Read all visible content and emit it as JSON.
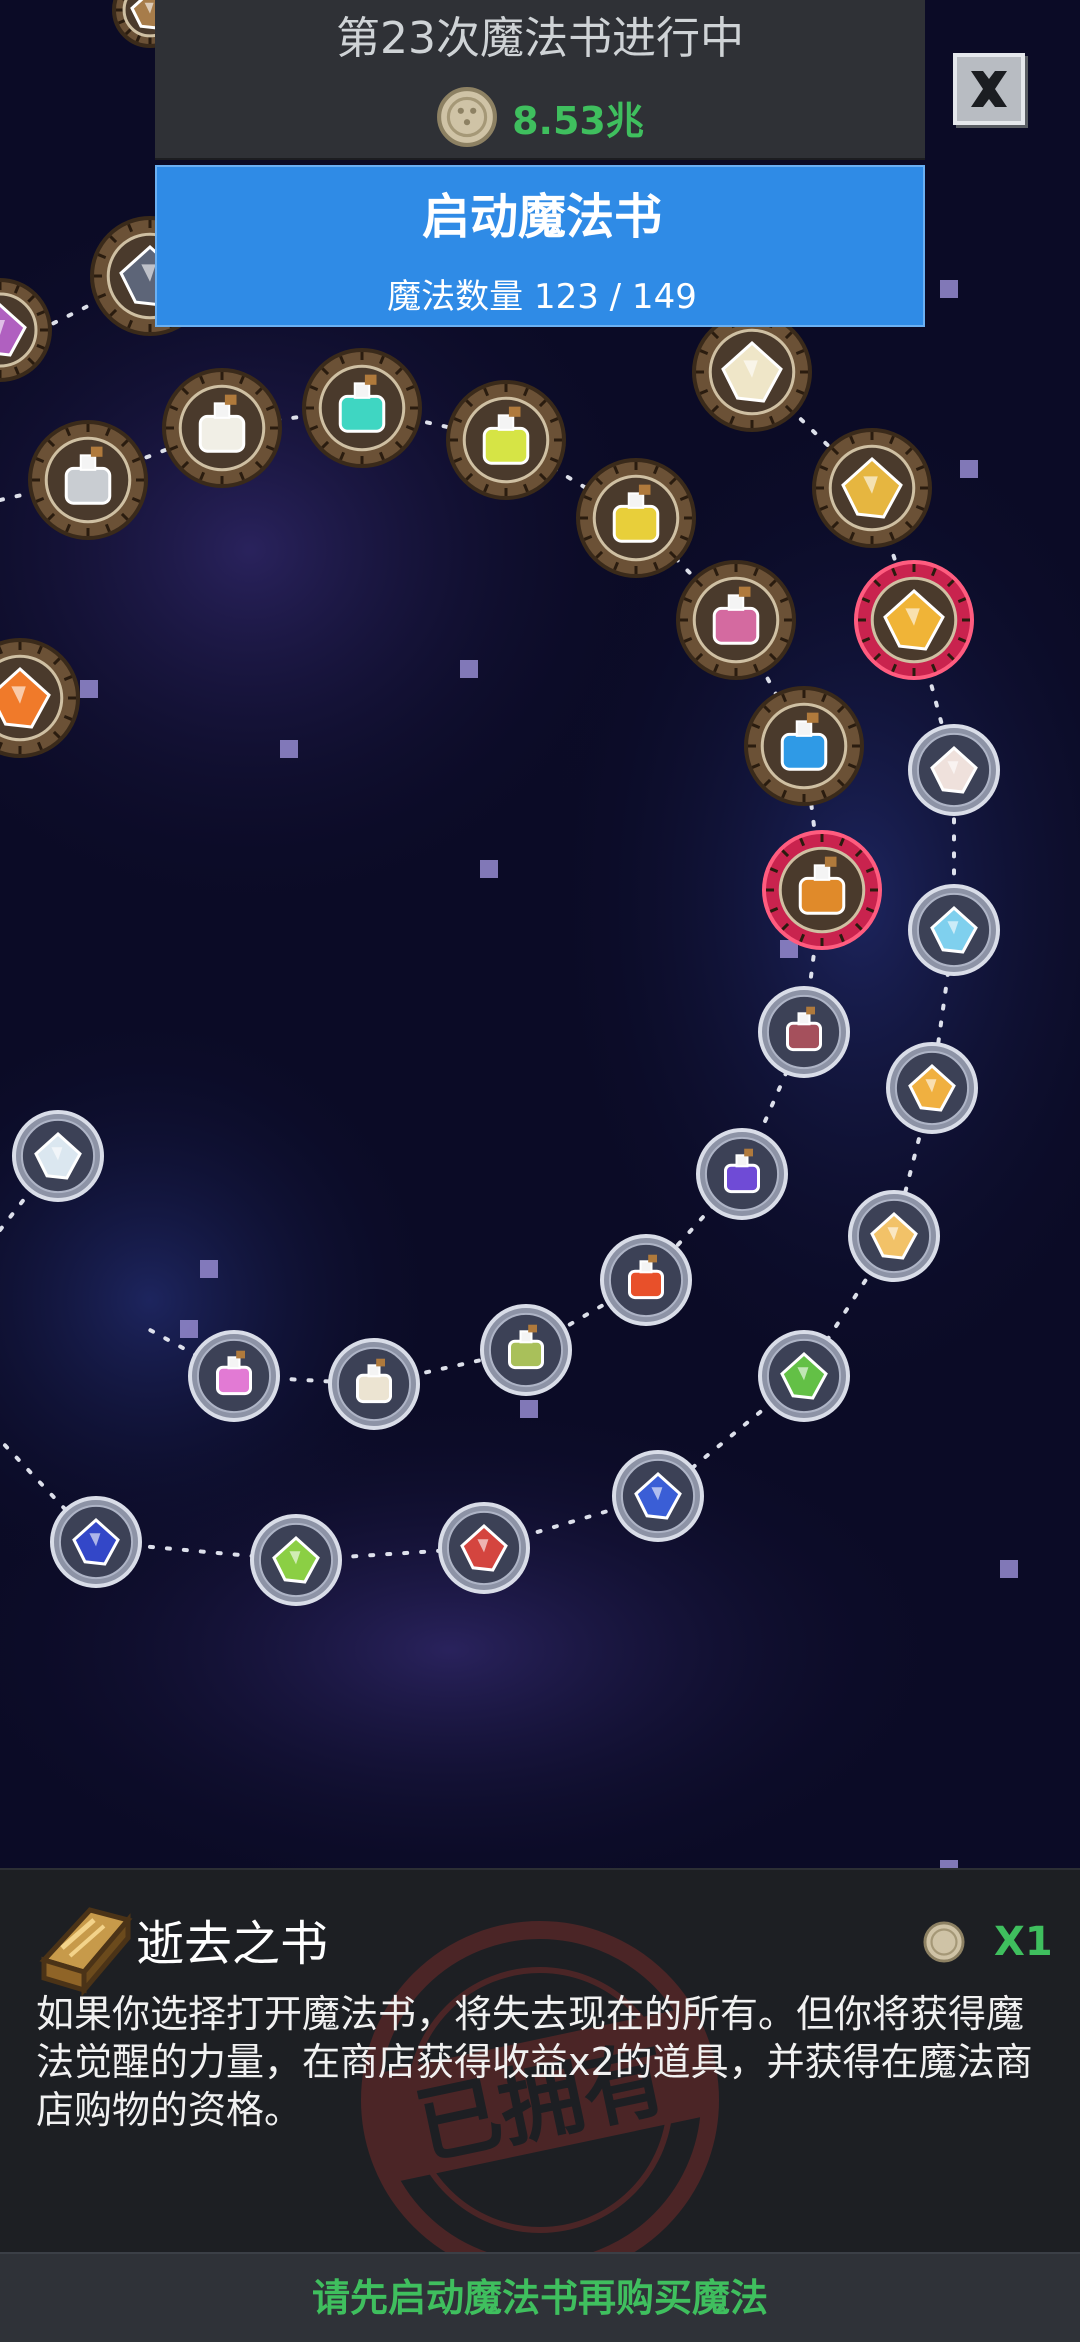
{
  "header": {
    "title": "第23次魔法书进行中",
    "coin_amount": "8.53兆",
    "coin_icon": "coin-icon"
  },
  "start_button": {
    "label": "启动魔法书",
    "count_label": "魔法数量",
    "count_value": "123 / 149"
  },
  "close_icon": "close-icon",
  "map": {
    "nodes": [
      {
        "name": "node-potion-gray",
        "item": "gray-potion-icon",
        "ring": "brown",
        "color": "#c9cdd2"
      },
      {
        "name": "node-potion-white",
        "item": "white-potion-icon",
        "ring": "brown",
        "color": "#f1efe6"
      },
      {
        "name": "node-potion-teal",
        "item": "teal-potion-icon",
        "ring": "brown",
        "color": "#3fd6c2"
      },
      {
        "name": "node-potion-lime",
        "item": "lime-potion-icon",
        "ring": "brown",
        "color": "#d6e445"
      },
      {
        "name": "node-potion-yellow",
        "item": "yellow-potion-icon",
        "ring": "brown",
        "color": "#e8cf3a"
      },
      {
        "name": "node-potion-pink",
        "item": "pink-potion-icon",
        "ring": "brown",
        "color": "#d46aa0"
      },
      {
        "name": "node-potion-blue",
        "item": "blue-potion-icon",
        "ring": "brown",
        "color": "#2f9ae6"
      },
      {
        "name": "node-potion-orange",
        "item": "orange-potion-icon",
        "ring": "red",
        "color": "#e08a2a"
      },
      {
        "name": "node-potion-maroon",
        "item": "maroon-potion-icon",
        "ring": "glass",
        "color": "#a5505c"
      },
      {
        "name": "node-potion-purple",
        "item": "purple-potion-icon",
        "ring": "glass",
        "color": "#6f4bd6"
      },
      {
        "name": "node-potion-red",
        "item": "red-potion-icon",
        "ring": "glass",
        "color": "#e8502a"
      },
      {
        "name": "node-potion-olive",
        "item": "olive-potion-icon",
        "ring": "glass",
        "color": "#a9c05a"
      },
      {
        "name": "node-potion-sand",
        "item": "sand-potion-icon",
        "ring": "glass",
        "color": "#ece4d2"
      },
      {
        "name": "node-potion-rainbow",
        "item": "rainbow-potion-icon",
        "ring": "glass",
        "color": "#e27ad4"
      },
      {
        "name": "node-gold-ingot",
        "item": "gold-ingot-icon",
        "ring": "brown",
        "color": "#efe6c8"
      },
      {
        "name": "node-gold-nugget",
        "item": "gold-nugget-icon",
        "ring": "brown",
        "color": "#e6b640"
      },
      {
        "name": "node-gold-bar-active",
        "item": "gold-bar-icon",
        "ring": "red",
        "color": "#f0b437"
      },
      {
        "name": "node-pearl",
        "item": "pearl-icon",
        "ring": "glass",
        "color": "#efe1dc"
      },
      {
        "name": "node-crystal",
        "item": "crystal-icon",
        "ring": "glass",
        "color": "#7fd0ee"
      },
      {
        "name": "node-topaz",
        "item": "topaz-icon",
        "ring": "glass",
        "color": "#f0b040"
      },
      {
        "name": "node-amber-bar",
        "item": "amber-bar-icon",
        "ring": "glass",
        "color": "#f2c268"
      },
      {
        "name": "node-green-crystal",
        "item": "green-crystal-icon",
        "ring": "glass",
        "color": "#63c046"
      },
      {
        "name": "node-sapphire",
        "item": "sapphire-icon",
        "ring": "glass",
        "color": "#3a5ed6"
      },
      {
        "name": "node-ruby",
        "item": "ruby-icon",
        "ring": "glass",
        "color": "#d4453f"
      },
      {
        "name": "node-emerald",
        "item": "emerald-icon",
        "ring": "glass",
        "color": "#8bcf44"
      },
      {
        "name": "node-blue-gem",
        "item": "blue-gem-icon",
        "ring": "glass",
        "color": "#3347c8"
      },
      {
        "name": "node-diamond",
        "item": "diamond-icon",
        "ring": "glass",
        "color": "#dbe7f0"
      },
      {
        "name": "node-fire-edge",
        "item": "fire-icon",
        "ring": "brown",
        "color": "#f07a2a"
      },
      {
        "name": "node-dark-gem-edge",
        "item": "dark-gem-icon",
        "ring": "brown",
        "color": "#5d6578"
      },
      {
        "name": "node-edge-left",
        "item": "purple-item-icon",
        "ring": "brown",
        "color": "#b060c0"
      },
      {
        "name": "node-edge-top",
        "item": "brown-item-icon",
        "ring": "brown",
        "color": "#a77c4a"
      }
    ]
  },
  "info": {
    "book_icon": "book-icon",
    "title": "逝去之书",
    "cost": "X1",
    "description": "如果你选择打开魔法书，将失去现在的所有。但你将获得魔法觉醒的力量，在商店获得收益x2的道具，并获得在魔法商店购物的资格。",
    "stamp_text": "已拥有"
  },
  "bottom_button": {
    "label": "请先启动魔法书再购买魔法"
  }
}
